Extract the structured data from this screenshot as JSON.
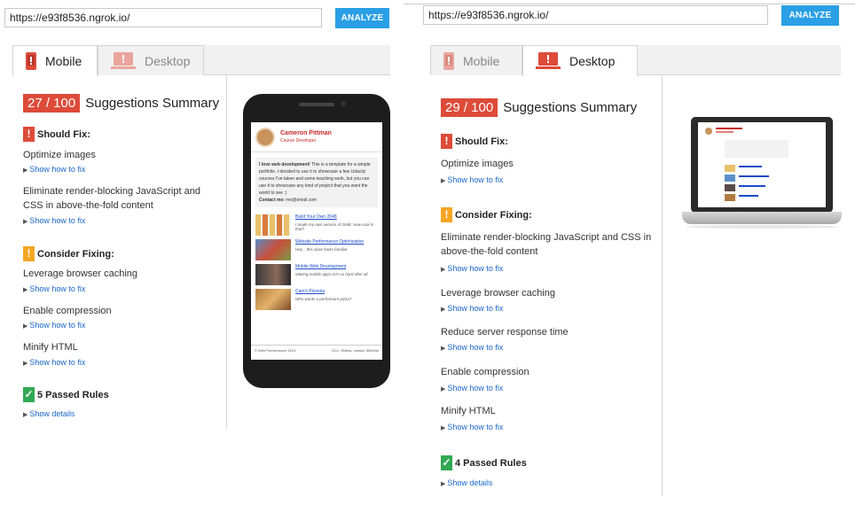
{
  "left": {
    "url": "https://e93f8536.ngrok.io/",
    "analyze_label": "ANALYZE",
    "tabs": [
      {
        "label": "Mobile",
        "active": true
      },
      {
        "label": "Desktop",
        "active": false
      }
    ],
    "score": "27 / 100",
    "summary_title": "Suggestions Summary",
    "should_fix_title": "Should Fix:",
    "should_fix": [
      "Optimize images",
      "Eliminate render-blocking JavaScript and CSS in above-the-fold content"
    ],
    "consider_title": "Consider Fixing:",
    "consider": [
      "Leverage browser caching",
      "Enable compression",
      "Minify HTML"
    ],
    "show_how": "Show how to fix",
    "passed_title": "5 Passed Rules",
    "show_details": "Show details"
  },
  "right": {
    "url": "https://e93f8536.ngrok.io/",
    "analyze_label": "ANALYZE",
    "tabs": [
      {
        "label": "Mobile",
        "active": false
      },
      {
        "label": "Desktop",
        "active": true
      }
    ],
    "score": "29 / 100",
    "summary_title": "Suggestions Summary",
    "should_fix_title": "Should Fix:",
    "should_fix": [
      "Optimize images"
    ],
    "consider_title": "Consider Fixing:",
    "consider": [
      "Eliminate render-blocking JavaScript and CSS in above-the-fold content",
      "Leverage browser caching",
      "Reduce server response time",
      "Enable compression",
      "Minify HTML"
    ],
    "show_how": "Show how to fix",
    "passed_title": "4 Passed Rules",
    "show_details": "Show details"
  },
  "preview": {
    "name": "Cameron Pittman",
    "role": "Course Developer",
    "bio_bold": "I love web development!",
    "bio": " This is a template for a simple portfolio. I decided to use it to showcase a few Udacity courses I've taken and some teaching work, but you can use it to showcase any kind of project that you want the world to see :)",
    "contact_label": "Contact me:",
    "contact_email": "me@email.com",
    "items": [
      {
        "link": "Build Your Own 2048",
        "caption": "I made my own version of 2048. How cool is that?"
      },
      {
        "link": "Website Performance Optimization",
        "caption": "Hey... this class looks familiar."
      },
      {
        "link": "Mobile Web Development",
        "caption": "Making mobile apps isn't so hard after all."
      },
      {
        "link": "Cam's Pizzeria",
        "caption": "Who wants a performant pizza?"
      }
    ],
    "footer_left": "© Web Performance 2014",
    "footer_right": "DCL: 565ms, onload: 5590ms"
  },
  "colors": {
    "accent": "#2a9fe6",
    "score": "#dd4b39",
    "should_fix": "#dd4b39",
    "consider": "#f5a623",
    "passed": "#33a854",
    "link": "#1a66c9"
  },
  "icons": [
    "phone-icon",
    "laptop-icon",
    "exclamation-icon",
    "checkmark-icon",
    "triangle-arrow-icon"
  ]
}
